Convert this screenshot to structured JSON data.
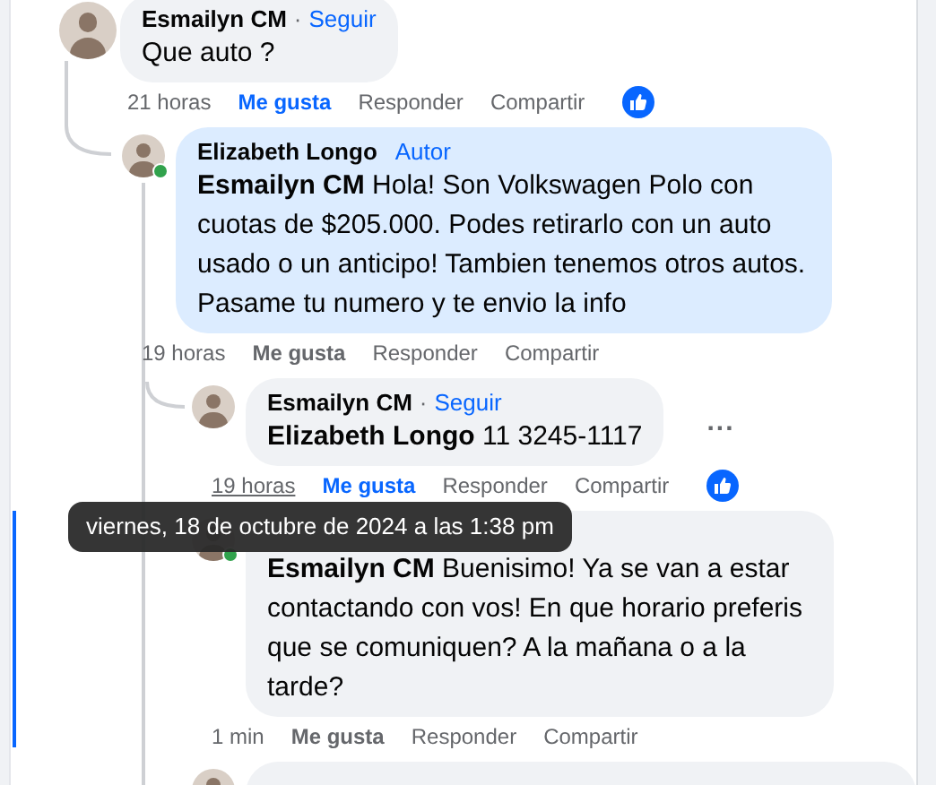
{
  "comments": [
    {
      "author": "Esmailyn CM",
      "separator": "·",
      "follow": "Seguir",
      "text": "Que auto ?",
      "time": "21 horas",
      "time_underlined": false,
      "like": "Me gusta",
      "liked": true,
      "reply": "Responder",
      "share": "Compartir",
      "reaction": true,
      "online": false,
      "highlighted": false,
      "focused": false,
      "children": [
        {
          "author": "Elizabeth Longo",
          "badge": "Autor",
          "text": "**Esmailyn CM** Hola! Son Volkswagen Polo con cuotas de $205.000. Podes retirarlo con un auto usado o un anticipo! Tambien tenemos otros autos. Pasame tu numero y te envio la info",
          "time": "19 horas",
          "time_underlined": false,
          "like": "Me gusta",
          "liked": false,
          "reply": "Responder",
          "share": "Compartir",
          "reaction": false,
          "online": true,
          "highlighted": true,
          "focused": false,
          "children": [
            {
              "author": "Esmailyn CM",
              "separator": "·",
              "follow": "Seguir",
              "text": "**Elizabeth Longo** 11 3245-1117",
              "more": "...",
              "time": "19 horas",
              "time_underlined": true,
              "like": "Me gusta",
              "liked": true,
              "reply": "Responder",
              "share": "Compartir",
              "reaction": true,
              "online": false,
              "highlighted": false,
              "focused": false
            },
            {
              "text": "**Esmailyn CM** Buenisimo! Ya se van a estar contactando con vos! En que horario preferis que se comuniquen? A la mañana o a la tarde?",
              "time": "1 min",
              "time_underlined": false,
              "like": "Me gusta",
              "liked": false,
              "reply": "Responder",
              "share": "Compartir",
              "reaction": false,
              "online": true,
              "highlighted": false,
              "focused": true
            },
            {
              "kind": "partial"
            }
          ]
        }
      ]
    }
  ],
  "tooltip": {
    "text": "viernes, 18 de octubre de 2024 a las 1:38 pm"
  }
}
